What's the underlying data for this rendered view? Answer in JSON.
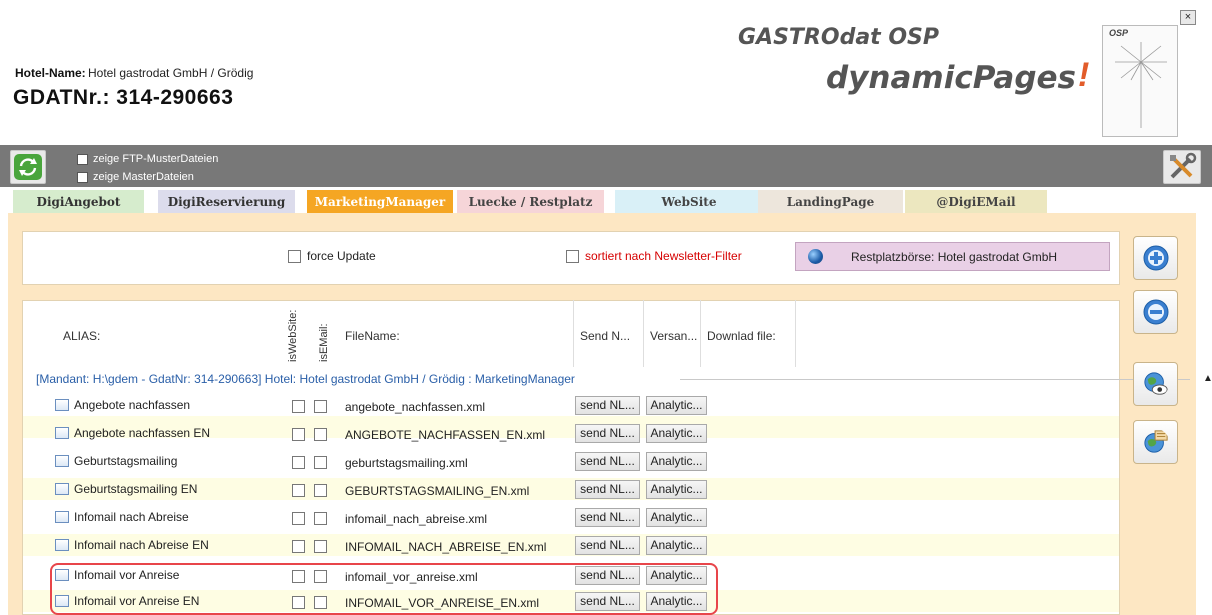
{
  "header": {
    "hotel_label": "Hotel-Name:",
    "hotel_name": "Hotel gastrodat GmbH / Grödig",
    "gdat_label": "GDATNr.:",
    "gdat_number": "314-290663",
    "brand_line1": "GASTROdat OSP",
    "brand_line2": "dynamicPages",
    "brand_exclaim": "!",
    "logo_text": "OSP",
    "close_label": "×"
  },
  "toolbar": {
    "cb1_label": "zeige FTP-MusterDateien",
    "cb2_label": "zeige MasterDateien"
  },
  "tabs": [
    {
      "label": "DigiAngebot",
      "bg": "#d6eccd",
      "color": "#333333"
    },
    {
      "label": "DigiReservierung",
      "bg": "#dcdcec",
      "color": "#333333"
    },
    {
      "label": "MarketingManager",
      "bg": "#f5a623",
      "color": "#ffffff"
    },
    {
      "label": "Luecke / Restplatz",
      "bg": "#f6d5d8",
      "color": "#444444"
    },
    {
      "label": "WebSite",
      "bg": "#d9f0f7",
      "color": "#444444"
    },
    {
      "label": "LandingPage",
      "bg": "#ede6dc",
      "color": "#444444"
    },
    {
      "label": "@DigiEMail",
      "bg": "#ece7bf",
      "color": "#444444"
    }
  ],
  "filter": {
    "force_update": "force Update",
    "sort_newsletter": "sortiert nach Newsletter-Filter",
    "restplatz": "Restplatzbörse: Hotel gastrodat GmbH"
  },
  "grid": {
    "col_alias": "ALIAS:",
    "col_iswebsite": "isWebSite:",
    "col_isemail": "isEMail:",
    "col_filename": "FileName:",
    "col_send": "Send N...",
    "col_versand": "Versan...",
    "col_download": "Downlad file:",
    "group_label": "[Mandant: H:\\gdem - GdatNr: 314-290663] Hotel:  Hotel gastrodat GmbH / Grödig : MarketingManager",
    "rows": [
      {
        "alias": "Angebote nachfassen",
        "file": "angebote_nachfassen.xml",
        "send": "send NL...",
        "versand": "Analytic..."
      },
      {
        "alias": "Angebote nachfassen EN",
        "file": "ANGEBOTE_NACHFASSEN_EN.xml",
        "send": "send NL...",
        "versand": "Analytic..."
      },
      {
        "alias": "Geburtstagsmailing",
        "file": "geburtstagsmailing.xml",
        "send": "send NL...",
        "versand": "Analytic..."
      },
      {
        "alias": "Geburtstagsmailing EN",
        "file": "GEBURTSTAGSMAILING_EN.xml",
        "send": "send NL...",
        "versand": "Analytic..."
      },
      {
        "alias": "Infomail nach Abreise",
        "file": "infomail_nach_abreise.xml",
        "send": "send NL...",
        "versand": "Analytic..."
      },
      {
        "alias": "Infomail nach Abreise EN",
        "file": "INFOMAIL_NACH_ABREISE_EN.xml",
        "send": "send NL...",
        "versand": "Analytic..."
      },
      {
        "alias": "Infomail vor Anreise",
        "file": "infomail_vor_anreise.xml",
        "send": "send NL...",
        "versand": "Analytic..."
      },
      {
        "alias": "Infomail vor Anreise EN",
        "file": "INFOMAIL_VOR_ANREISE_EN.xml",
        "send": "send NL...",
        "versand": "Analytic..."
      }
    ]
  },
  "side_buttons": [
    {
      "icon": "plus-icon"
    },
    {
      "icon": "minus-icon"
    },
    {
      "icon": "globe-eye-icon"
    },
    {
      "icon": "globe-spellcheck-icon"
    }
  ],
  "colors": {
    "accent": "#f5a623",
    "panel_bg": "#fde7c3",
    "toolbar_bg": "#787878",
    "highlight": "#e8454a",
    "group_text": "#2a5fa8"
  }
}
